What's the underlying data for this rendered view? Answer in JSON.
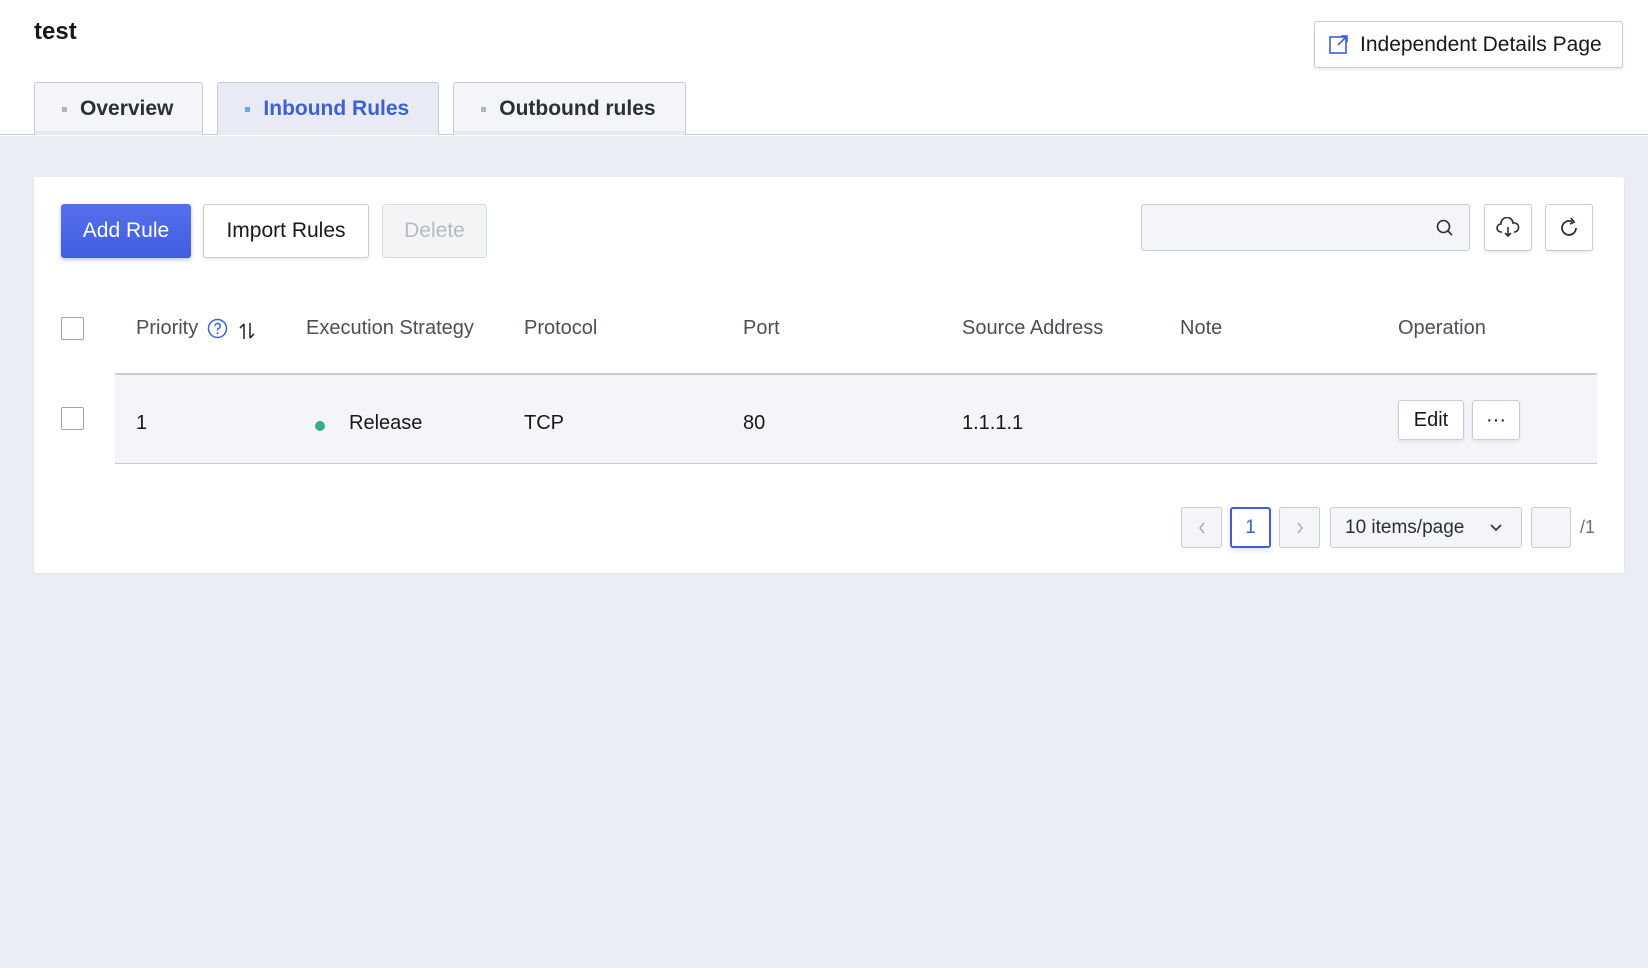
{
  "page": {
    "title": "test",
    "detail_button": "Independent Details Page"
  },
  "tabs": [
    {
      "label": "Overview",
      "active": false
    },
    {
      "label": "Inbound Rules",
      "active": true
    },
    {
      "label": "Outbound rules",
      "active": false
    }
  ],
  "toolbar": {
    "add_rule": "Add Rule",
    "import_rules": "Import Rules",
    "delete": "Delete",
    "search_placeholder": "",
    "search_icon": "search-icon",
    "download_icon": "cloud-download-icon",
    "refresh_icon": "refresh-icon"
  },
  "table": {
    "columns": [
      "Priority",
      "Execution Strategy",
      "Protocol",
      "Port",
      "Source Address",
      "Note",
      "Operation"
    ],
    "rows": [
      {
        "priority": "1",
        "strategy": "Release",
        "protocol": "TCP",
        "port": "80",
        "source": "1.1.1.1",
        "note": "",
        "edit": "Edit",
        "more": "···"
      }
    ]
  },
  "pagination": {
    "current": "1",
    "page_size": "10 items/page",
    "page_input": "",
    "total": "/1"
  },
  "colors": {
    "primary": "#3e5fd6",
    "status_release": "#33b08a",
    "background": "#ebedf5"
  }
}
